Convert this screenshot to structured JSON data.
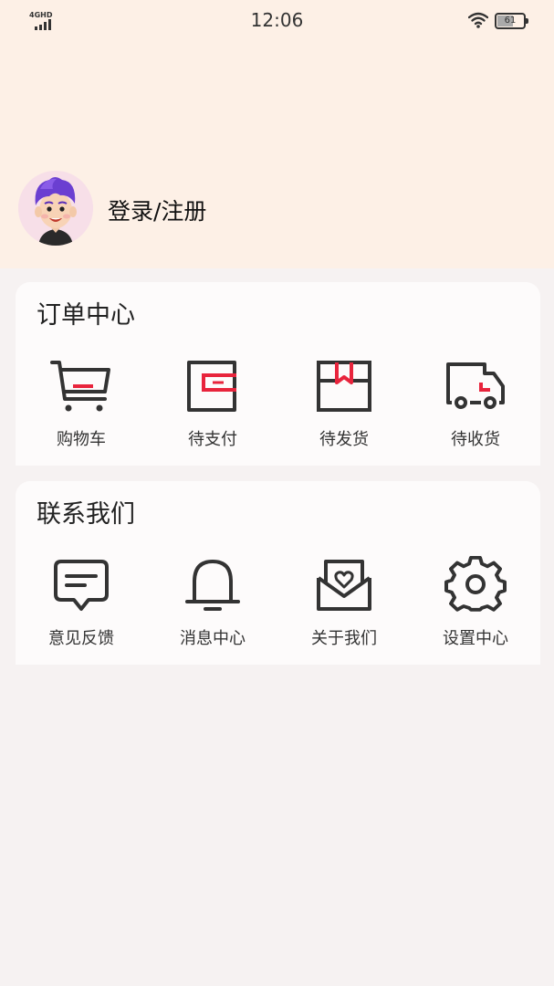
{
  "status_bar": {
    "network": "4GHD",
    "time": "12:06",
    "battery": "61"
  },
  "profile": {
    "login_label": "登录/注册"
  },
  "order_center": {
    "title": "订单中心",
    "items": [
      {
        "label": "购物车",
        "icon": "cart-icon"
      },
      {
        "label": "待支付",
        "icon": "wallet-icon"
      },
      {
        "label": "待发货",
        "icon": "package-icon"
      },
      {
        "label": "待收货",
        "icon": "truck-icon"
      }
    ]
  },
  "contact": {
    "title": "联系我们",
    "items": [
      {
        "label": "意见反馈",
        "icon": "feedback-icon"
      },
      {
        "label": "消息中心",
        "icon": "bell-icon"
      },
      {
        "label": "关于我们",
        "icon": "mail-heart-icon"
      },
      {
        "label": "设置中心",
        "icon": "gear-icon"
      }
    ]
  },
  "colors": {
    "header_bg": "#fdf0e6",
    "page_bg": "#f6f2f2",
    "accent": "#e8243c",
    "icon_stroke": "#333333"
  }
}
